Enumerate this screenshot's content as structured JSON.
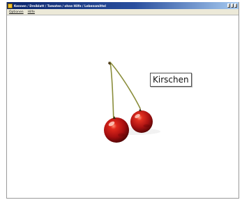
{
  "window": {
    "title": "Kennen / Dreiblatt / Tomaten / ohne Hilfe / Lebensmittel"
  },
  "menu": {
    "items": [
      "Optionen",
      "Hilfe"
    ]
  },
  "main": {
    "word_label": "Kirschen"
  },
  "colors": {
    "titlebar_start": "#0a246a",
    "titlebar_end": "#a6caf0",
    "cherry_red": "#b21616",
    "stem_green": "#8a8d3a"
  },
  "icons": {
    "app_icon": "app-icon",
    "title_buttons": [
      "minimize-icon",
      "maximize-icon",
      "close-icon"
    ],
    "picture": "cherries-image"
  }
}
